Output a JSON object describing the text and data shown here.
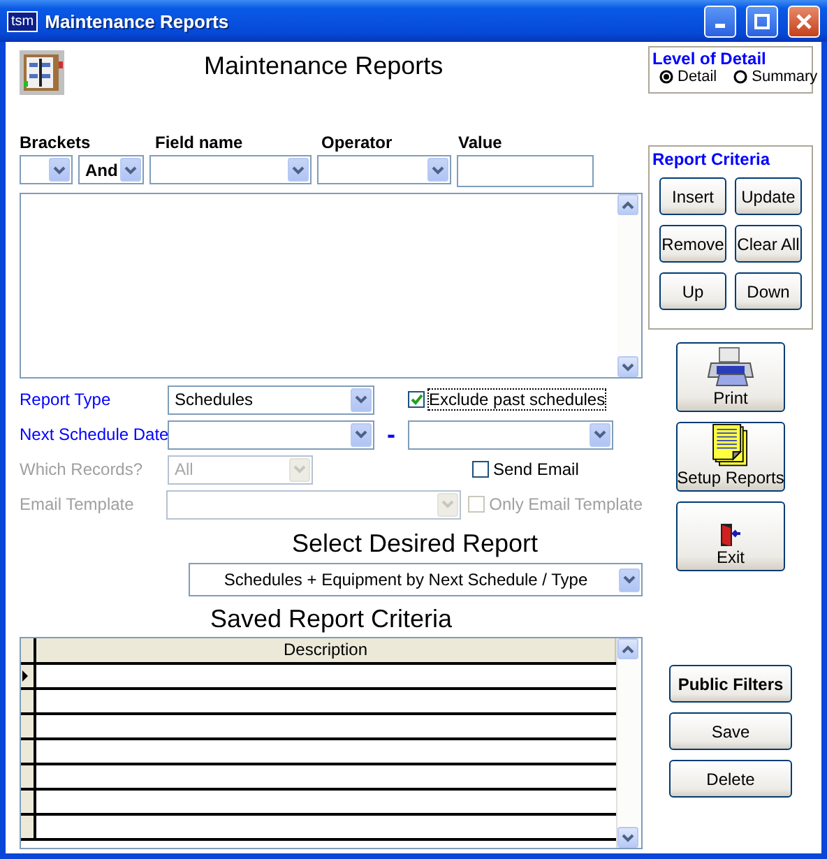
{
  "window": {
    "badge": "tsm",
    "title": "Maintenance Reports"
  },
  "heading": "Maintenance Reports",
  "level_of_detail": {
    "title": "Level of Detail",
    "options": [
      {
        "label": "Detail",
        "selected": true
      },
      {
        "label": "Summary",
        "selected": false
      }
    ]
  },
  "criteria_columns": [
    "Brackets",
    "Field name",
    "Operator",
    "Value"
  ],
  "criteria_row": {
    "conjunction": "And"
  },
  "report_criteria": {
    "title": "Report Criteria",
    "buttons": [
      "Insert",
      "Update",
      "Remove",
      "Clear All",
      "Up",
      "Down"
    ]
  },
  "side_buttons": [
    {
      "kind": "print",
      "label": "Print"
    },
    {
      "kind": "setup",
      "label": "Setup Reports"
    },
    {
      "kind": "exit",
      "label": "Exit"
    }
  ],
  "fields": [
    {
      "kind": "single",
      "label": "Report Type",
      "value": "Schedules",
      "disabled": false,
      "checkbox": {
        "label": "Exclude past schedules",
        "checked": true,
        "disabled": false,
        "focused": true
      }
    },
    {
      "kind": "range",
      "label": "Next Schedule Date",
      "disabled": false,
      "separator": "-"
    },
    {
      "kind": "single",
      "label": "Which Records?",
      "value": "All",
      "disabled": true,
      "checkbox": {
        "label": "Send Email",
        "checked": false,
        "disabled": false,
        "focused": false
      }
    },
    {
      "kind": "single",
      "label": "Email Template",
      "disabled": true,
      "checkbox": {
        "label": "Only Email Template",
        "checked": false,
        "disabled": true,
        "focused": false
      }
    }
  ],
  "report_select": {
    "title": "Select Desired Report",
    "value": "Schedules + Equipment by Next Schedule / Type"
  },
  "saved_criteria": {
    "title": "Saved Report Criteria",
    "columns": [
      "Description"
    ],
    "rows": [
      {
        "selected": true
      },
      {
        "selected": false
      },
      {
        "selected": false
      },
      {
        "selected": false
      },
      {
        "selected": false
      },
      {
        "selected": false
      },
      {
        "selected": false
      }
    ]
  },
  "filter_buttons": [
    {
      "kind": "bold",
      "label": "Public Filters"
    },
    {
      "kind": "plain",
      "label": "Save"
    },
    {
      "kind": "plain",
      "label": "Delete"
    }
  ]
}
